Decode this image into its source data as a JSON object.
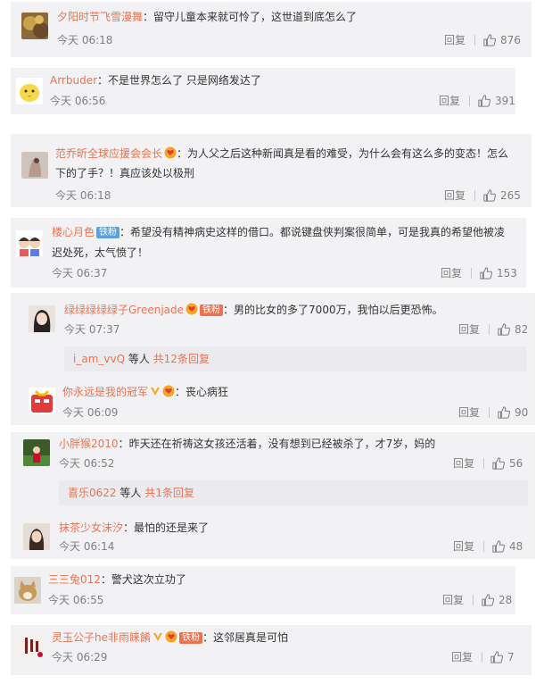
{
  "comments": [
    {
      "user": "夕阳时节飞雪漫舞",
      "colon": "：",
      "text": "留守儿童本来就可怜了，这世道到底怎么了",
      "time": "今天 06:18",
      "reply": "回复",
      "likes": "876"
    },
    {
      "user": "Arrbuder",
      "colon": "：",
      "text": "不是世界怎么了 只是网络发达了",
      "time": "今天 06:56",
      "reply": "回复",
      "likes": "391"
    },
    {
      "user": "范乔昕全球应援会会长",
      "colon": "：",
      "text_line1": "为人父之后这种新闻真是看的难受，为什么会有这么多的变态！怎么",
      "text_line2": "下的了手？！真应该处以极刑",
      "time": "今天 06:18",
      "reply": "回复",
      "likes": "265"
    },
    {
      "user": "楼心月色",
      "badge": "铁粉",
      "colon": "：",
      "text_line1": "希望没有精神病史这样的借口。都说键盘侠判案很简单，可是我真的希望他被凌",
      "text_line2": "迟处死，太气愤了！",
      "time": "今天 06:37",
      "reply": "回复",
      "likes": "153"
    },
    {
      "user": "绿绿绿绿绿子Greenjade",
      "badge": "铁粉",
      "colon": "：",
      "text": "男的比女的多了7000万，我怕以后更恐怖。",
      "time": "今天 07:37",
      "reply": "回复",
      "likes": "82",
      "sub_user": "i_am_vvQ",
      "sub_mid": " 等人 ",
      "sub_count": "共12条回复"
    },
    {
      "user": "你永远是我的冠军",
      "colon": "：",
      "text": "丧心病狂",
      "time": "今天 06:09",
      "reply": "回复",
      "likes": "90"
    },
    {
      "user": "小胖猴2010",
      "colon": "：",
      "text": "昨天还在祈祷这女孩还活着，没有想到已经被杀了，才7岁，妈的",
      "time": "今天 06:52",
      "reply": "回复",
      "likes": "56",
      "sub_user": "喜乐0622",
      "sub_mid": " 等人 ",
      "sub_count": "共1条回复"
    },
    {
      "user": "抹茶少女沫汐",
      "colon": "：",
      "text": "最怕的还是来了",
      "time": "今天 06:14",
      "reply": "回复",
      "likes": "48"
    },
    {
      "user": "三三兔012",
      "colon": "：",
      "text": "警犬这次立功了",
      "time": "今天 06:55",
      "reply": "回复",
      "likes": "28"
    },
    {
      "user": "灵玉公子he非雨睐餚",
      "badge": "铁粉",
      "colon": "：",
      "text": "这邻居真是可怕",
      "time": "今天 06:29",
      "reply": "回复",
      "likes": "7"
    }
  ],
  "icons": {
    "like": "thumbs-up-icon",
    "vip": "vip-v-icon",
    "heart_badge": "fan-heart-icon"
  },
  "colors": {
    "username": "#eb7350",
    "meta": "#808080",
    "card_bg": "#f2f2f5"
  }
}
